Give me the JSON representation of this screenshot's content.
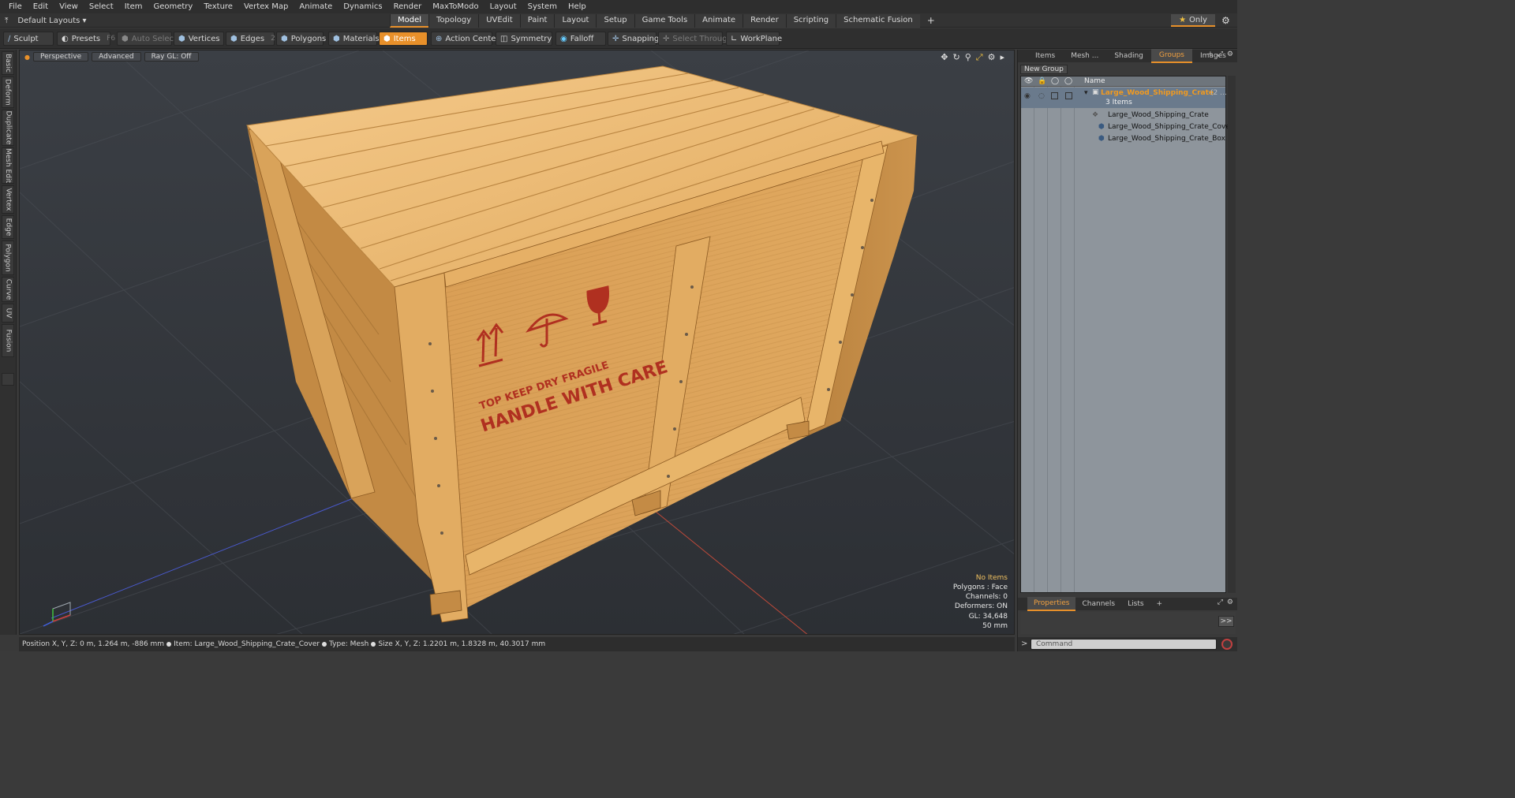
{
  "menubar": {
    "items": [
      "File",
      "Edit",
      "View",
      "Select",
      "Item",
      "Geometry",
      "Texture",
      "Vertex Map",
      "Animate",
      "Dynamics",
      "Render",
      "MaxToModo",
      "Layout",
      "System",
      "Help"
    ]
  },
  "layoutbar": {
    "layout_label": "Default Layouts",
    "tabs": [
      "Model",
      "Topology",
      "UVEdit",
      "Paint",
      "Layout",
      "Setup",
      "Game Tools",
      "Animate",
      "Render",
      "Scripting",
      "Schematic Fusion"
    ],
    "active_tab": "Model",
    "add_label": "+",
    "only_label": "Only"
  },
  "toolbar": {
    "sculpt": "Sculpt",
    "presets": "Presets",
    "presets_key": "F6",
    "auto_select": "Auto Select",
    "vertices": "Vertices",
    "vertices_key": "1",
    "edges": "Edges",
    "edges_key": "2",
    "polygons": "Polygons",
    "materials": "Materials",
    "items": "Items",
    "action_center": "Action Center",
    "symmetry": "Symmetry",
    "falloff": "Falloff",
    "snapping": "Snapping",
    "select_through": "Select Through",
    "workplane": "WorkPlane"
  },
  "lefttabs": [
    "Basic",
    "Deform",
    "Duplicate",
    "Mesh Edit",
    "Vertex",
    "Edge",
    "Polygon",
    "Curve",
    "UV",
    "Fusion"
  ],
  "viewport": {
    "view_label": "Perspective",
    "advanced_label": "Advanced",
    "raygl_label": "Ray GL: Off",
    "crate_text": {
      "line1": "TOP  KEEP DRY  FRAGILE",
      "line2": "HANDLE WITH CARE"
    },
    "info": {
      "selection": "No Items",
      "polygons": "Polygons : Face",
      "channels": "Channels: 0",
      "deformers": "Deformers: ON",
      "gl": "GL: 34,648",
      "scale": "50 mm"
    }
  },
  "statusbar": {
    "position": "Position X, Y, Z:   0 m, 1.264 m, -886 mm",
    "item": "Item:  Large_Wood_Shipping_Crate_Cover",
    "type": "Type:  Mesh",
    "size": "Size X, Y, Z:   1.2201 m, 1.8328 m, 40.3017 mm"
  },
  "rightpanel": {
    "tabs": [
      "Items",
      "Mesh ...",
      "Shading",
      "Groups",
      "Images"
    ],
    "active_tab": "Groups",
    "new_group": "New Group",
    "name_header": "Name",
    "group_name": "Large_Wood_Shipping_Crate",
    "group_suffix": "(2 ...",
    "group_count": "3 Items",
    "children": [
      "Large_Wood_Shipping_Crate",
      "Large_Wood_Shipping_Crate_Cover",
      "Large_Wood_Shipping_Crate_Box"
    ],
    "prop_tabs": [
      "Properties",
      "Channels",
      "Lists"
    ],
    "prop_active": "Properties",
    "expand_label": ">>",
    "command_placeholder": "Command"
  },
  "colors": {
    "accent": "#e8902a",
    "group_text": "#f09a20",
    "crate_wood": "#e8b060",
    "stencil_red": "#b03020"
  }
}
